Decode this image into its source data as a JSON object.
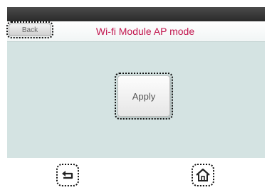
{
  "header": {
    "back_label": "Back",
    "title": "Wi-fi Module AP mode"
  },
  "main": {
    "apply_label": "Apply"
  },
  "footer": {
    "icons": [
      "return-icon",
      "home-icon"
    ]
  },
  "colors": {
    "title": "#c2174f",
    "screen_background": "#d4e3e2",
    "top_bar": "#2f2f2f",
    "highlight_outline": "#111111"
  }
}
